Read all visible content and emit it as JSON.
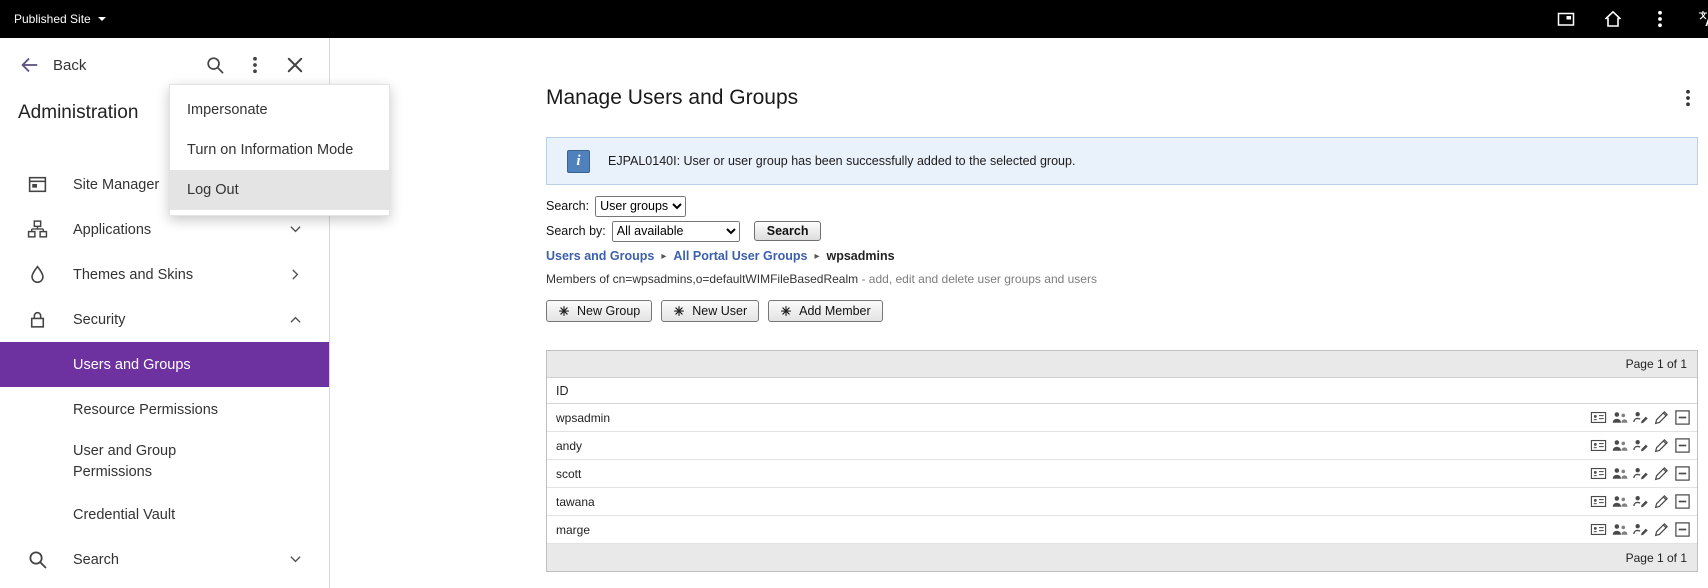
{
  "topbar": {
    "published_site": "Published Site"
  },
  "sidebar": {
    "back_label": "Back",
    "title": "Administration",
    "items": [
      {
        "label": "Site Manager"
      },
      {
        "label": "Applications"
      },
      {
        "label": "Themes and Skins"
      },
      {
        "label": "Security"
      },
      {
        "label": "Users and Groups",
        "selected": true
      },
      {
        "label": "Resource Permissions"
      },
      {
        "label": "User and Group Permissions"
      },
      {
        "label": "Credential Vault"
      },
      {
        "label": "Search"
      }
    ]
  },
  "menu": {
    "items": [
      {
        "label": "Impersonate"
      },
      {
        "label": "Turn on Information Mode"
      },
      {
        "label": "Log Out",
        "highlighted": true
      }
    ]
  },
  "main": {
    "title": "Manage Users and Groups",
    "info_message": "EJPAL0140I: User or user group has been successfully added to the selected group.",
    "search_label": "Search:",
    "search_value": "User groups",
    "search_by_label": "Search by:",
    "search_by_value": "All available",
    "search_button": "Search",
    "breadcrumb_sep": "▸",
    "breadcrumb": [
      {
        "label": "Users and Groups"
      },
      {
        "label": "All Portal User Groups"
      },
      {
        "label": "wpsadmins"
      }
    ],
    "members_text": "Members of cn=wpsadmins,o=defaultWIMFileBasedRealm",
    "members_hint": " - add, edit and delete user groups and users",
    "buttons": [
      {
        "label": "New Group"
      },
      {
        "label": "New User"
      },
      {
        "label": "Add Member"
      }
    ],
    "table": {
      "pager": "Page 1 of 1",
      "id_header": "ID",
      "rows": [
        {
          "id": "wpsadmin"
        },
        {
          "id": "andy"
        },
        {
          "id": "scott"
        },
        {
          "id": "tawana"
        },
        {
          "id": "marge"
        }
      ]
    }
  },
  "icons": {
    "info_glyph": "i",
    "topbar": [
      "console-icon",
      "home-icon",
      "kebab-icon",
      "translate-icon"
    ],
    "row_actions": [
      "id-card-icon",
      "membership-icon",
      "edit-profile-icon",
      "edit-icon",
      "remove-icon"
    ]
  },
  "colors": {
    "accent_purple": "#6e32a0",
    "link_blue": "#3c61aa",
    "info_bg": "#e9f1fa",
    "info_icon_blue": "#4f81bd",
    "topbar_bg": "#000000"
  }
}
